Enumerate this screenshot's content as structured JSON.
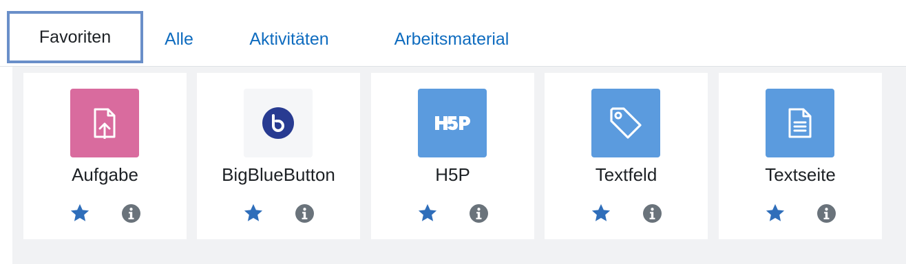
{
  "tabs": [
    {
      "label": "Favoriten",
      "active": true
    },
    {
      "label": "Alle",
      "active": false
    },
    {
      "label": "Aktivitäten",
      "active": false
    },
    {
      "label": "Arbeitsmaterial",
      "active": false
    }
  ],
  "modules": [
    {
      "label": "Aufgabe",
      "icon": "assignment-upload-icon",
      "tile_color": "#d96b9e",
      "favourite": true
    },
    {
      "label": "BigBlueButton",
      "icon": "bigbluebutton-icon",
      "tile_color": "#f5f6f8",
      "favourite": true
    },
    {
      "label": "H5P",
      "icon": "h5p-icon",
      "tile_color": "#5b9bde",
      "favourite": true
    },
    {
      "label": "Textfeld",
      "icon": "tag-icon",
      "tile_color": "#5b9bde",
      "favourite": true
    },
    {
      "label": "Textseite",
      "icon": "page-icon",
      "tile_color": "#5b9bde",
      "favourite": true
    }
  ],
  "colors": {
    "link": "#0f6cbf",
    "star": "#2f6eba",
    "info": "#6a737b",
    "active_tab_border": "#6a8fc9",
    "background": "#f1f2f4"
  }
}
